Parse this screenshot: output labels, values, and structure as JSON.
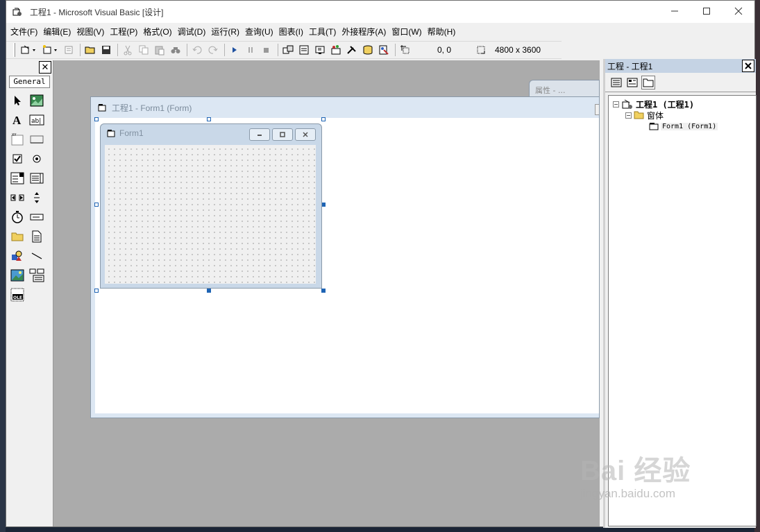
{
  "window": {
    "title": "工程1 - Microsoft Visual Basic [设计]"
  },
  "menu": [
    "文件(F)",
    "编辑(E)",
    "视图(V)",
    "工程(P)",
    "格式(O)",
    "调试(D)",
    "运行(R)",
    "查询(U)",
    "图表(I)",
    "工具(T)",
    "外接程序(A)",
    "窗口(W)",
    "帮助(H)"
  ],
  "toolbar": {
    "position": "0, 0",
    "size": "4800 x 3600"
  },
  "toolbox": {
    "tab_label": "General",
    "close_label": "✕"
  },
  "project_explorer": {
    "title": "工程 - 工程1",
    "tree": {
      "root": "工程1 (工程1)",
      "folder": "窗体",
      "item": "Form1 (Form1)"
    }
  },
  "properties_peek": {
    "title": "属性 - ..."
  },
  "designer": {
    "title": "工程1 - Form1 (Form)",
    "form_caption": "Form1"
  },
  "watermark": {
    "logo": "Bai 经验",
    "url": "jingyan.baidu.com"
  }
}
